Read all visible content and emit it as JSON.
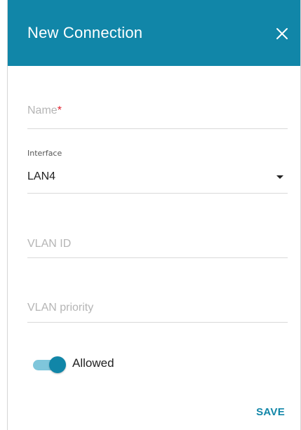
{
  "dialog": {
    "title": "New Connection",
    "close_icon": "close-icon",
    "accent_color": "#1186a8"
  },
  "form": {
    "name_field": {
      "placeholder": "Name",
      "required_marker": "*",
      "value": ""
    },
    "interface_field": {
      "label": "Interface",
      "selected_value": "LAN4",
      "icon": "caret-down-icon"
    },
    "vlan_id_field": {
      "placeholder": "VLAN ID",
      "value": ""
    },
    "vlan_priority_field": {
      "placeholder": "VLAN priority",
      "value": ""
    },
    "allowed_toggle": {
      "label": "Allowed",
      "checked": true
    }
  },
  "actions": {
    "save_label": "SAVE"
  }
}
